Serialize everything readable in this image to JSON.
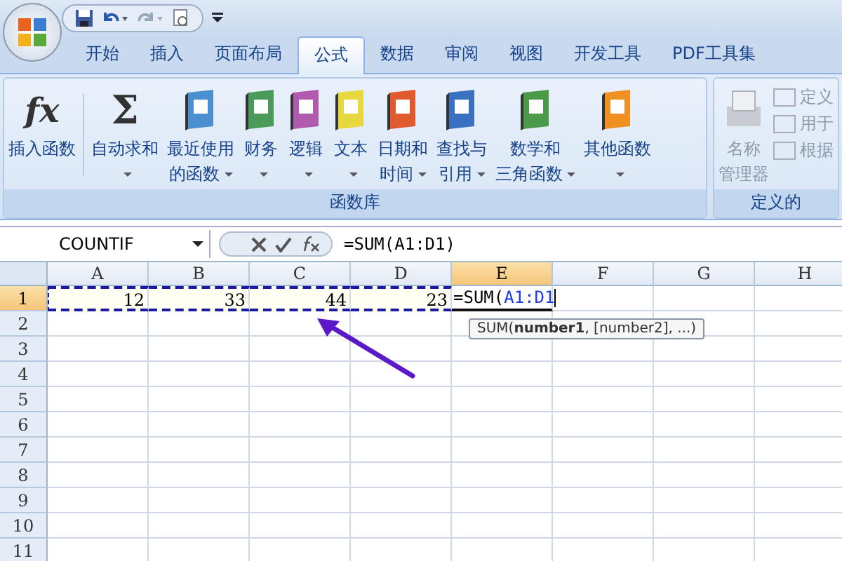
{
  "tabs": [
    {
      "label": "开始",
      "selected": false
    },
    {
      "label": "插入",
      "selected": false
    },
    {
      "label": "页面布局",
      "selected": false
    },
    {
      "label": "公式",
      "selected": true
    },
    {
      "label": "数据",
      "selected": false
    },
    {
      "label": "审阅",
      "selected": false
    },
    {
      "label": "视图",
      "selected": false
    },
    {
      "label": "开发工具",
      "selected": false
    },
    {
      "label": "PDF工具集",
      "selected": false
    }
  ],
  "ribbon": {
    "groups": [
      {
        "label": "函数库",
        "buttons": [
          {
            "kind": "glyph",
            "glyph": "fx",
            "lines": [
              "插入函数"
            ],
            "dropdown": false
          },
          {
            "kind": "glyph",
            "glyph": "Σ",
            "lines": [
              "自动求和"
            ],
            "dropdown": true
          },
          {
            "kind": "book",
            "color": "#4a90d0",
            "lines": [
              "最近使用",
              "的函数"
            ],
            "dropdown": true
          },
          {
            "kind": "book",
            "color": "#4a9a5a",
            "lines": [
              "财务"
            ],
            "dropdown": true
          },
          {
            "kind": "book",
            "color": "#b05ab0",
            "lines": [
              "逻辑"
            ],
            "dropdown": true
          },
          {
            "kind": "book",
            "color": "#e8d840",
            "lines": [
              "文本"
            ],
            "dropdown": true
          },
          {
            "kind": "book",
            "color": "#e05a30",
            "lines": [
              "日期和",
              "时间"
            ],
            "dropdown": true
          },
          {
            "kind": "book",
            "color": "#3a70c0",
            "lines": [
              "查找与",
              "引用"
            ],
            "dropdown": true
          },
          {
            "kind": "book",
            "color": "#4a9a4a",
            "lines": [
              "数学和",
              "三角函数"
            ],
            "dropdown": true
          },
          {
            "kind": "book",
            "color": "#f09020",
            "lines": [
              "其他函数"
            ],
            "dropdown": true
          }
        ]
      },
      {
        "label": "定义的",
        "large": {
          "lines": [
            "名称",
            "管理器"
          ]
        },
        "small": [
          "定义",
          "用于",
          "根据"
        ]
      }
    ]
  },
  "formula_bar": {
    "name_box": "COUNTIF",
    "formula": "=SUM(A1:D1)"
  },
  "sheet": {
    "columns": [
      {
        "label": "A",
        "selected": false
      },
      {
        "label": "B",
        "selected": false
      },
      {
        "label": "C",
        "selected": false
      },
      {
        "label": "D",
        "selected": false
      },
      {
        "label": "E",
        "selected": true
      },
      {
        "label": "F",
        "selected": false
      },
      {
        "label": "G",
        "selected": false
      },
      {
        "label": "H",
        "selected": false
      }
    ],
    "rows": [
      {
        "label": "1",
        "selected": true,
        "cells": [
          {
            "value": "12",
            "in_range": true
          },
          {
            "value": "33",
            "in_range": true
          },
          {
            "value": "44",
            "in_range": true
          },
          {
            "value": "23",
            "in_range": true
          },
          {
            "kind": "editing",
            "formula_prefix": "=SUM(",
            "reference": "A1:D1",
            "in_range": false
          }
        ]
      },
      {
        "label": "2",
        "selected": false
      },
      {
        "label": "3",
        "selected": false
      },
      {
        "label": "4",
        "selected": false
      },
      {
        "label": "5",
        "selected": false
      },
      {
        "label": "6",
        "selected": false
      },
      {
        "label": "7",
        "selected": false
      },
      {
        "label": "8",
        "selected": false
      },
      {
        "label": "9",
        "selected": false
      },
      {
        "label": "10",
        "selected": false
      },
      {
        "label": "11",
        "selected": false
      }
    ],
    "tooltip": "SUM(**number1**, [number2], ...)"
  }
}
